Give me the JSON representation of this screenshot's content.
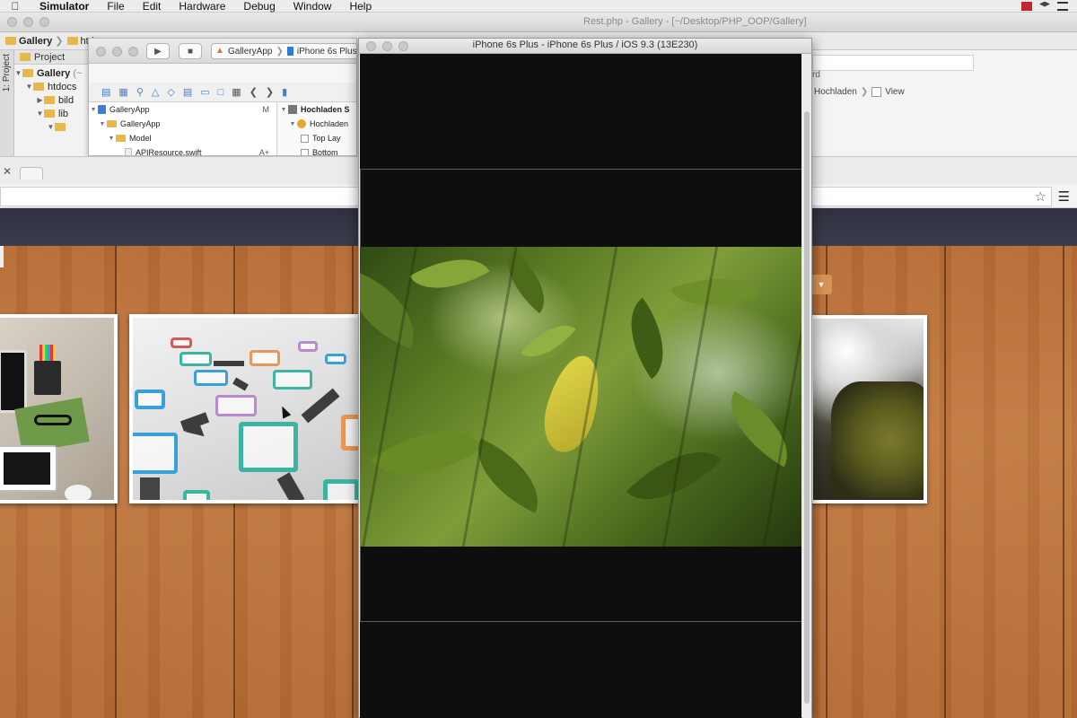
{
  "menubar": {
    "apple_icon": "apple-icon",
    "app": "Simulator",
    "items": [
      "File",
      "Edit",
      "Hardware",
      "Debug",
      "Window",
      "Help"
    ],
    "right_icons": [
      "battery-icon",
      "dropbox-icon",
      "menu-list-icon"
    ]
  },
  "ide": {
    "title": "Rest.php - Gallery - [~/Desktop/PHP_OOP/Gallery]",
    "breadcrumb": [
      "Gallery",
      "htdc"
    ],
    "side_tab": "1: Project",
    "project_label": "Project",
    "tree": [
      {
        "label": "Gallery",
        "suffix": "(~"
      },
      {
        "label": "htdocs",
        "suffix": ""
      },
      {
        "label": "bild",
        "suffix": ""
      },
      {
        "label": "lib",
        "suffix": ""
      },
      {
        "label": "",
        "suffix": ""
      }
    ],
    "right_truncated": "rd",
    "right_path": [
      "Hochladen",
      "View"
    ]
  },
  "xcode": {
    "scheme_app": "GalleryApp",
    "scheme_device": "iPhone 6s Plus",
    "navigator": [
      {
        "label": "GalleryApp",
        "badge": "M"
      },
      {
        "label": "GalleryApp",
        "badge": ""
      },
      {
        "label": "Model",
        "badge": ""
      },
      {
        "label": "APIResource.swift",
        "badge": "A+"
      }
    ],
    "outline": [
      {
        "label": "Hochladen S"
      },
      {
        "label": "Hochladen"
      },
      {
        "label": "Top Lay"
      },
      {
        "label": "Bottom"
      }
    ]
  },
  "simulator": {
    "title": "iPhone 6s Plus - iPhone 6s Plus / iOS 9.3 (13E230)"
  },
  "colors": {
    "wood": "#b66b35",
    "site_header": "#2f3140",
    "sim_screen": "#0e0e0e"
  }
}
